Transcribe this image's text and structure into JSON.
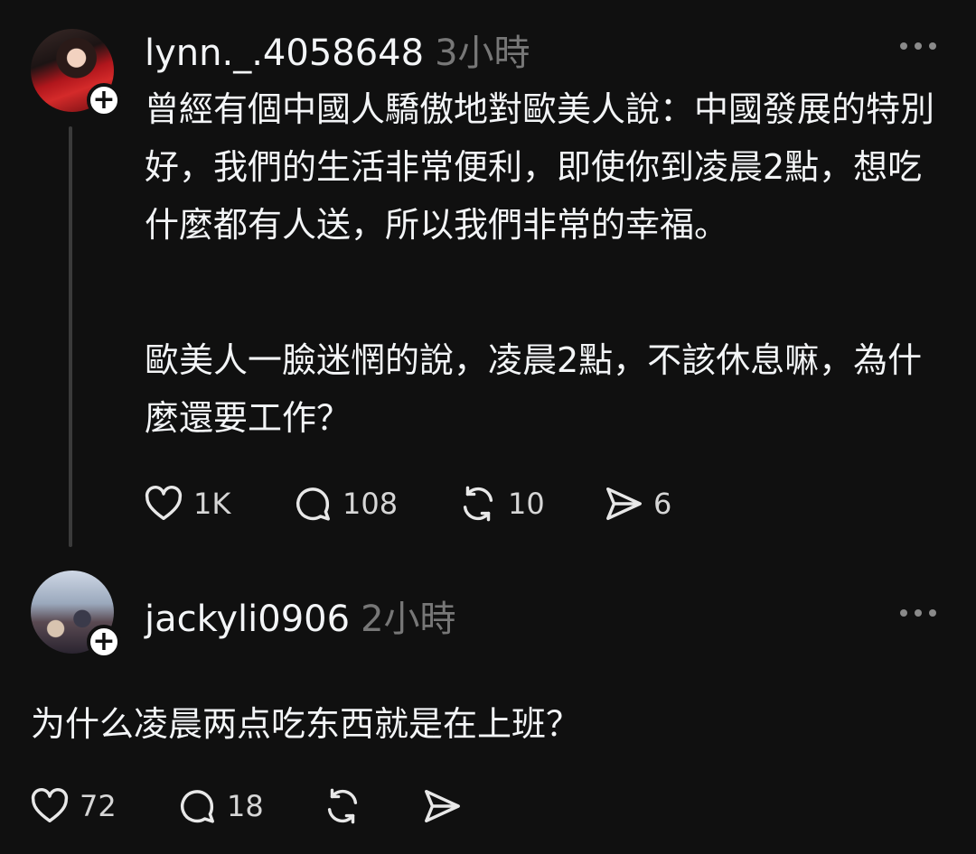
{
  "post": {
    "username": "lynn._.4058648",
    "time": "3小時",
    "paragraphs": [
      "曾經有個中國人驕傲地對歐美人說：中國發展的特別好，我們的生活非常便利，即使你到凌晨2點，想吃什麼都有人送，所以我們非常的幸福。",
      "歐美人一臉迷惘的說，凌晨2點，不該休息嘛，為什麼還要工作？"
    ],
    "actions": {
      "likes": "1K",
      "comments": "108",
      "reposts": "10",
      "shares": "6"
    }
  },
  "reply": {
    "username": "jackyli0906",
    "time": "2小時",
    "text": "为什么凌晨两点吃东西就是在上班？",
    "actions": {
      "likes": "72",
      "comments": "18"
    }
  },
  "icons": {
    "like": "heart-icon",
    "comment": "comment-bubble-icon",
    "repost": "repost-icon",
    "share": "send-icon",
    "more": "more-dots-icon",
    "follow": "plus-icon"
  },
  "colors": {
    "background": "#101010",
    "text": "#f3f5f7",
    "muted": "#777777",
    "thread_line": "#3a3a3a"
  }
}
